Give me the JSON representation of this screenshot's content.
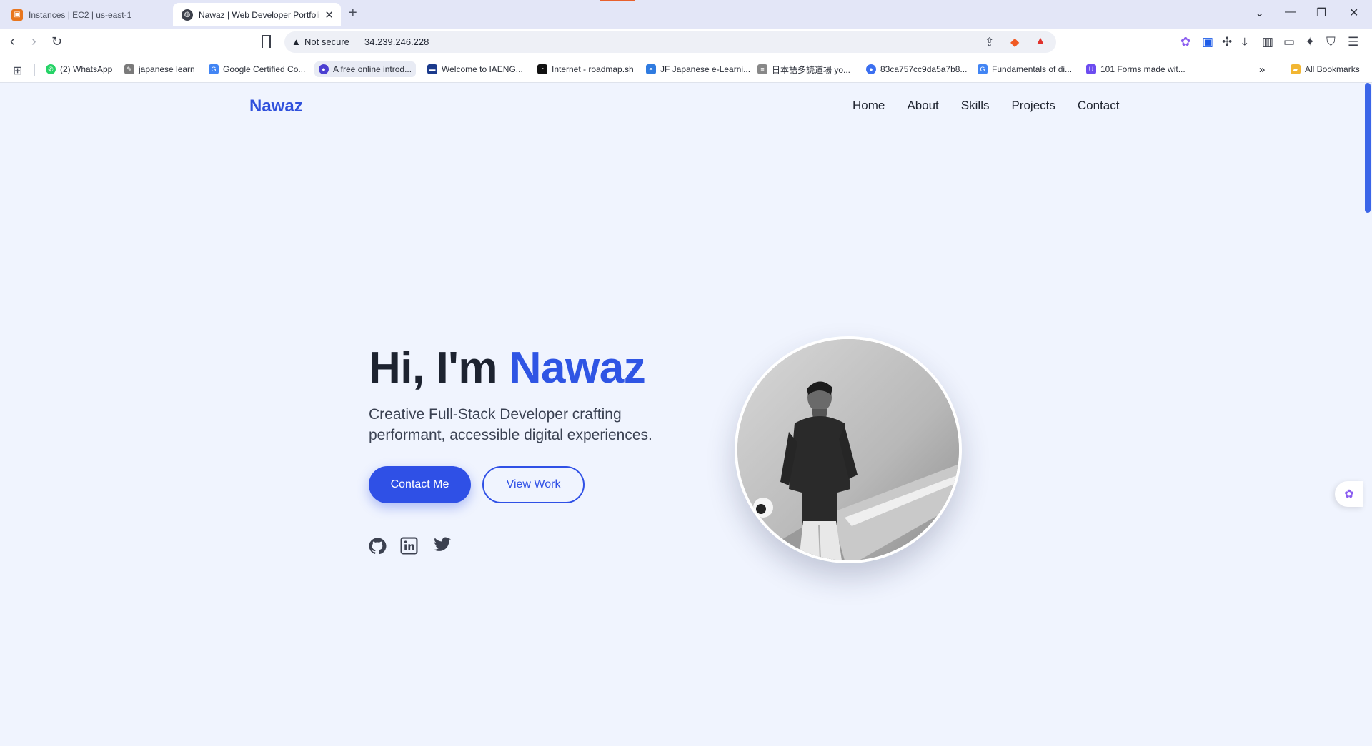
{
  "browser": {
    "tabs": [
      {
        "title": "Instances | EC2 | us-east-1",
        "icon": "aws-icon",
        "active": false
      },
      {
        "title": "Nawaz | Web Developer Portfoli",
        "icon": "globe-icon",
        "active": true
      }
    ],
    "address": {
      "security_label": "Not secure",
      "url": "34.239.246.228"
    },
    "bookmarks": [
      {
        "label": "(2) WhatsApp",
        "color": "#25d366"
      },
      {
        "label": "japanese learn",
        "color": "#555555"
      },
      {
        "label": "Google Certified Co...",
        "color": "#4285f4"
      },
      {
        "label": "A free online introd...",
        "color": "#4b3fd1"
      },
      {
        "label": "Welcome to IAENG...",
        "color": "#1b3a8c"
      },
      {
        "label": "Internet - roadmap.sh",
        "color": "#111111"
      },
      {
        "label": "JF Japanese e-Learni...",
        "color": "#2f7be0"
      },
      {
        "label": "日本語多読道場 yo...",
        "color": "#888888"
      },
      {
        "label": "83ca757cc9da5a7b8...",
        "color": "#3b6ff0"
      },
      {
        "label": "Fundamentals of di...",
        "color": "#4285f4"
      },
      {
        "label": "101 Forms made wit...",
        "color": "#6c4cf0"
      }
    ],
    "all_bookmarks_label": "All Bookmarks"
  },
  "site": {
    "logo": "Nawaz",
    "nav": [
      "Home",
      "About",
      "Skills",
      "Projects",
      "Contact"
    ],
    "hero": {
      "greeting": "Hi, I'm ",
      "name": "Nawaz",
      "subtitle": "Creative Full-Stack Developer crafting performant, accessible digital experiences.",
      "primary_button": "Contact Me",
      "secondary_button": "View Work",
      "social_icons": [
        "github-icon",
        "linkedin-icon",
        "twitter-icon"
      ]
    }
  },
  "colors": {
    "accent": "#2f50e6",
    "page_background": "#f0f4fe"
  }
}
